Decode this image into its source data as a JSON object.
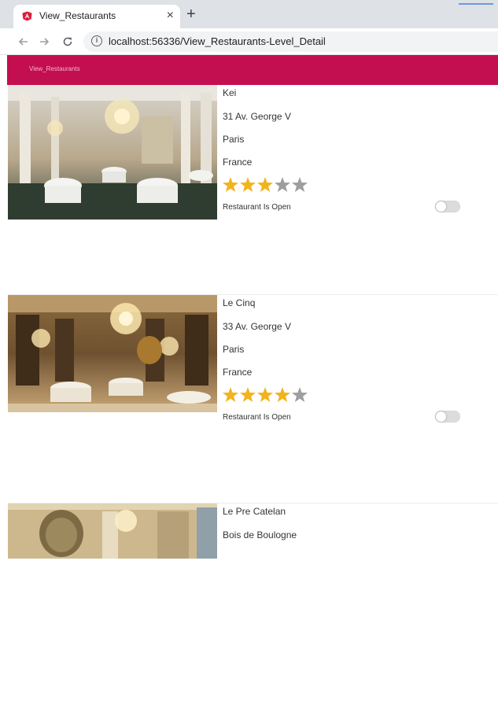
{
  "browser": {
    "tab_title": "View_Restaurants",
    "tab_close_glyph": "×",
    "new_tab_glyph": "+",
    "url_host": "localhost",
    "url_rest": ":56336/View_Restaurants-Level_Detail"
  },
  "app": {
    "title": "View_Restaurants",
    "accent": "#c30f4f"
  },
  "restaurants": [
    {
      "name": "Kei",
      "address": "31 Av. George V",
      "city": "Paris",
      "country": "France",
      "rating": 3,
      "max_rating": 5,
      "open_label": "Restaurant Is Open",
      "open": false
    },
    {
      "name": "Le Cinq",
      "address": "33 Av. George V",
      "city": "Paris",
      "country": "France",
      "rating": 4,
      "max_rating": 5,
      "open_label": "Restaurant Is Open",
      "open": false
    },
    {
      "name": "Le Pre Catelan",
      "address": "Bois de Boulogne"
    }
  ],
  "colors": {
    "star_filled": "#f1b41d",
    "star_empty": "#9e9e9e"
  }
}
